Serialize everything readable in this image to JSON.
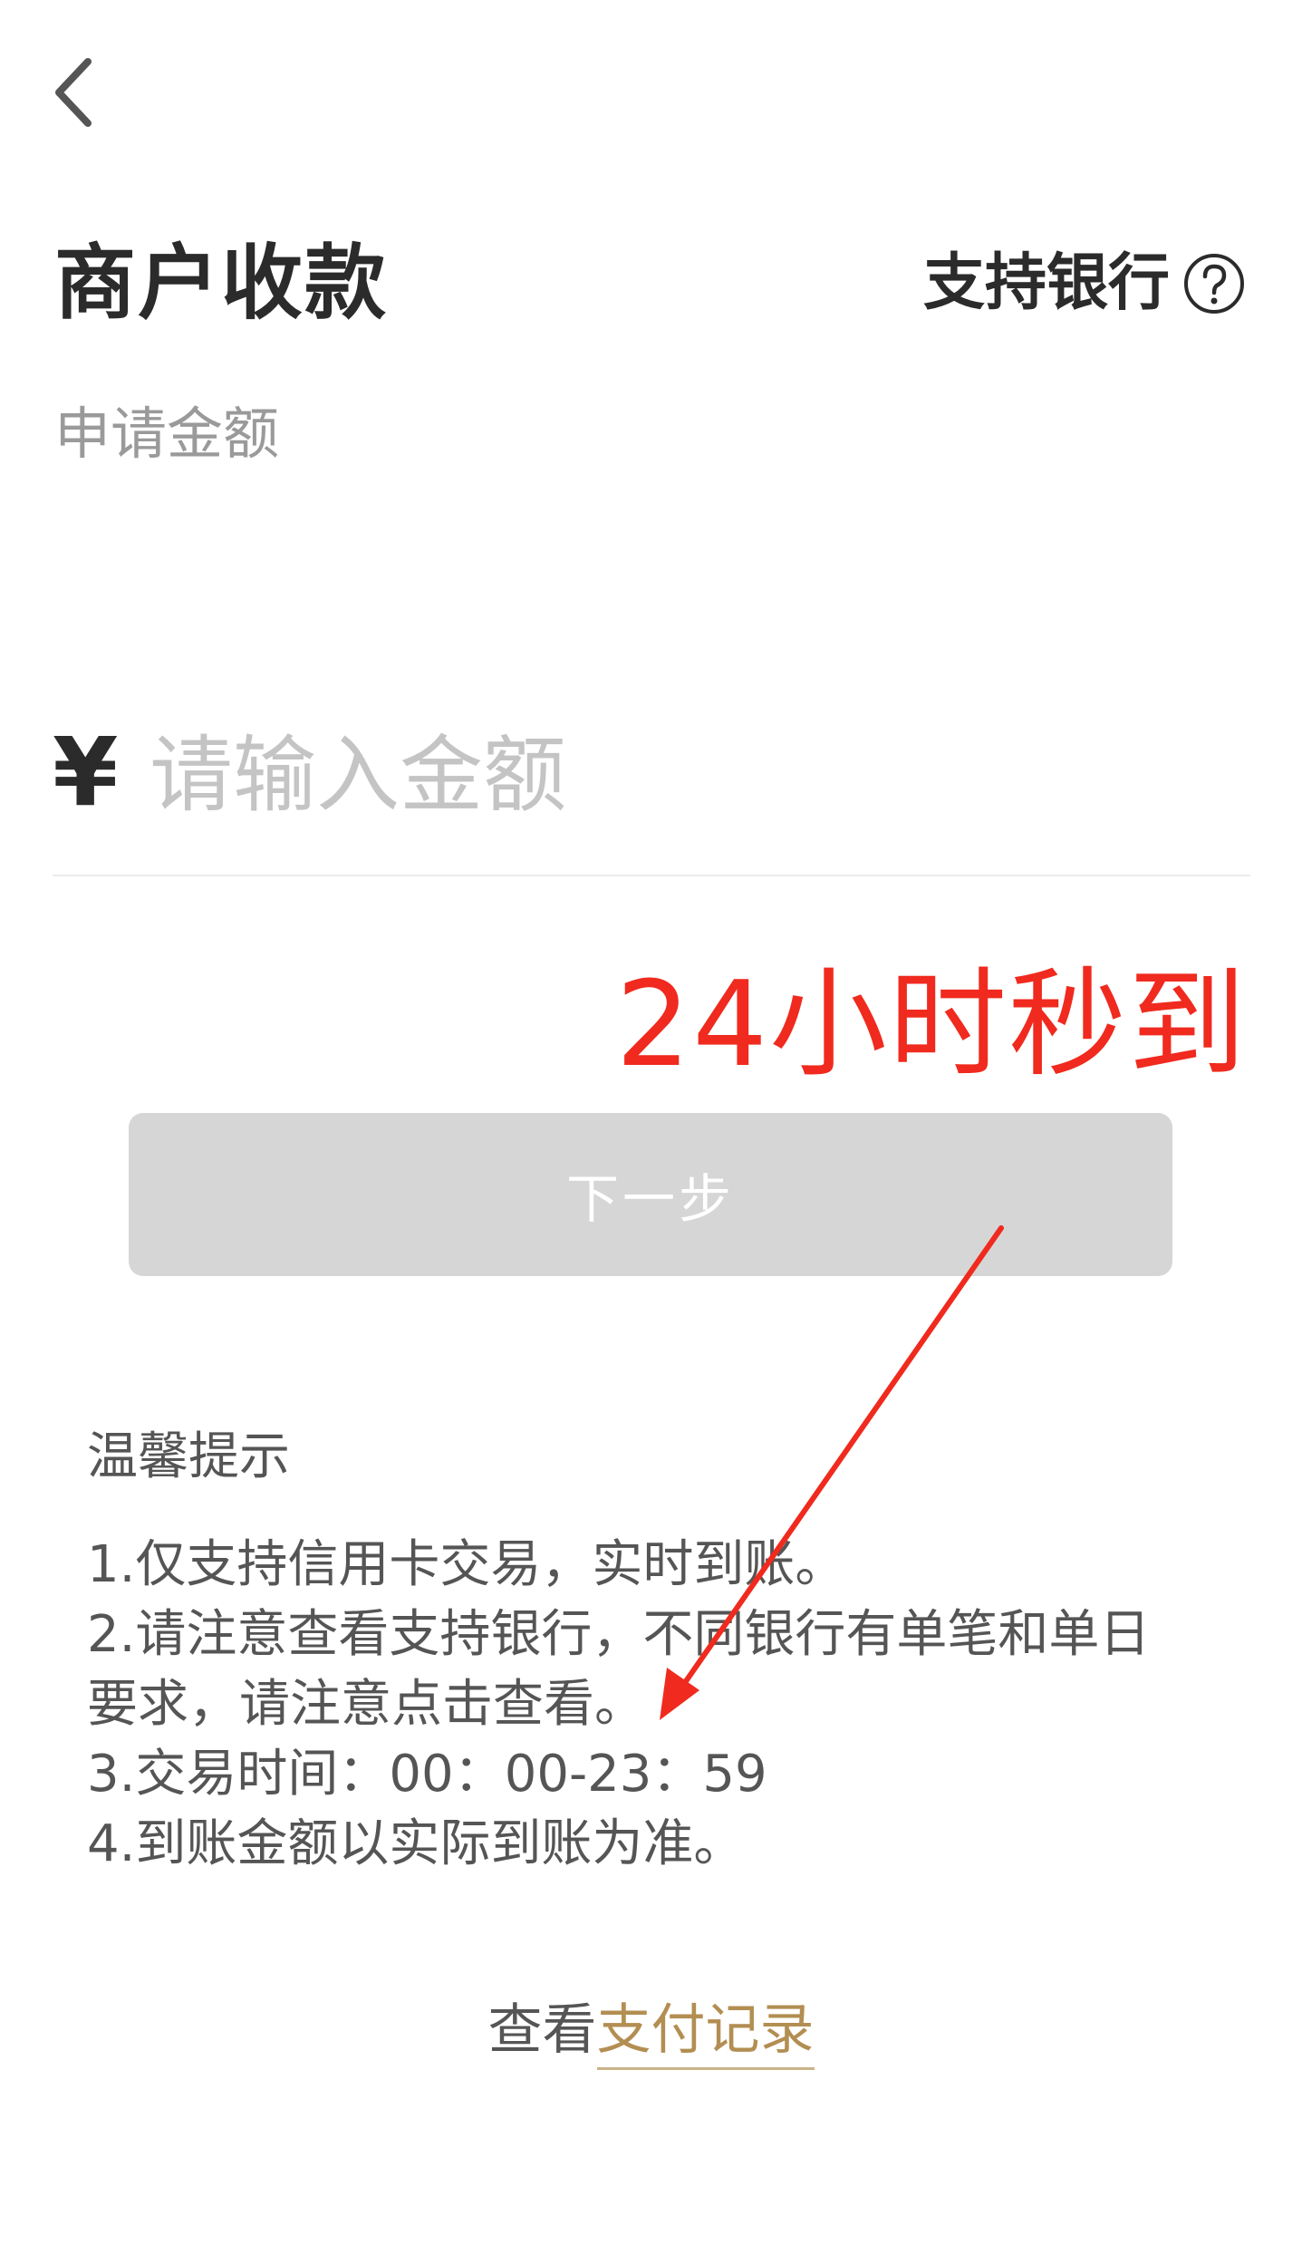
{
  "header": {
    "back_icon": "chevron-left-icon",
    "title": "商户收款",
    "supported_banks_label": "支持银行",
    "help_icon": "question-circle-icon"
  },
  "amount": {
    "label": "申请金额",
    "currency_symbol": "¥",
    "placeholder": "请输入金额",
    "value": ""
  },
  "annotation": {
    "text": "24小时秒到",
    "color": "#f02a1e"
  },
  "next_button": {
    "label": "下一步",
    "background": "#d6d6d6"
  },
  "tips": {
    "title": "温馨提示",
    "lines": [
      "1.仅支持信用卡交易，实时到账。",
      "2.请注意查看支持银行，不同银行有单笔和单日",
      "要求，请注意点击查看。",
      "3.交易时间：00：00-23：59",
      "4.到账金额以实际到账为准。"
    ]
  },
  "footer": {
    "prefix": "查看",
    "link": "支付记录",
    "link_color": "#b38e52"
  }
}
